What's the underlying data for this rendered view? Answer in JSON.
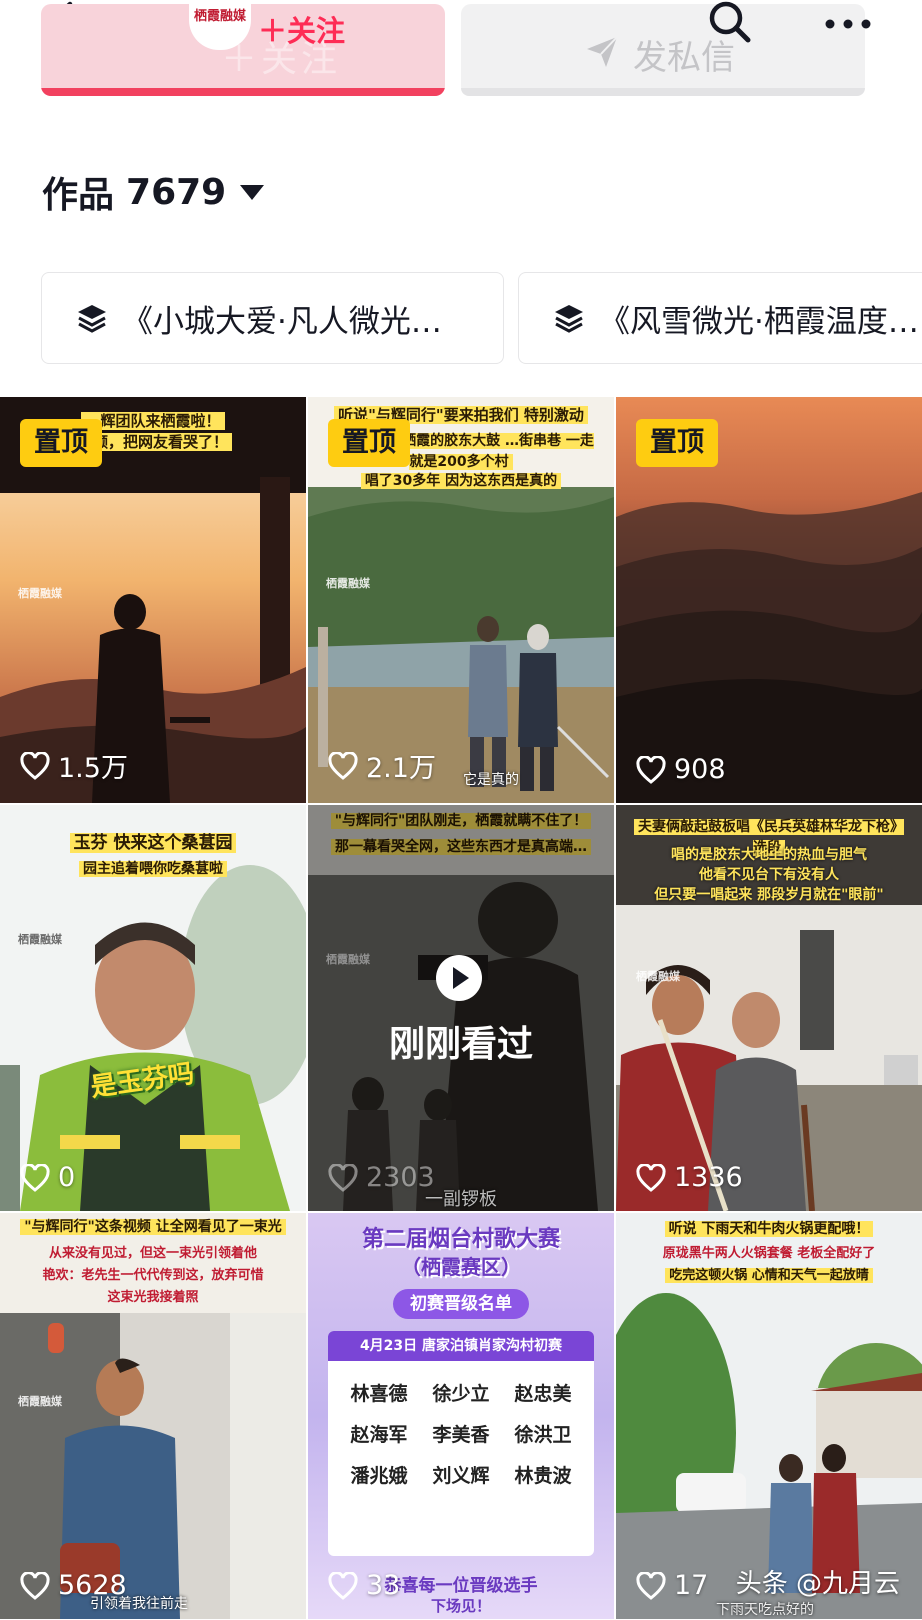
{
  "header": {
    "follow_label": "＋关注",
    "follow_ghost": "＋关注",
    "logo_text": "栖霞融媒",
    "message_label": "发私信"
  },
  "works": {
    "title": "作品",
    "count": "7679"
  },
  "collections": [
    {
      "label": "《小城大爱·凡人微光…"
    },
    {
      "label": "《风雪微光·栖霞温度…"
    }
  ],
  "videos": [
    {
      "pinned": "置顶",
      "caption": "…辉团队来栖霞啦！",
      "caption2": "…频，把网友看哭了！",
      "likes": "1.5万",
      "watermark": "栖霞融媒"
    },
    {
      "pinned": "置顶",
      "caption": "听说\"与辉同行\"要来拍我们 特别激动",
      "caption2": "…多人知道栖霞的胶东大鼓 …街串巷 一走就是200多个村",
      "caption3": "唱了30多年 因为这东西是真的",
      "foot": "它是真的",
      "likes": "2.1万",
      "watermark": "栖霞融媒"
    },
    {
      "pinned": "置顶",
      "likes": "908"
    },
    {
      "caption": "玉芬 快来这个桑葚园",
      "caption2": "园主追着喂你吃桑葚啦",
      "subtitle": "是玉芬吗",
      "likes": "0",
      "watermark": "栖霞融媒"
    },
    {
      "caption": "\"与辉同行\"团队刚走，栖霞就瞒不住了！",
      "caption2": "那一幕看哭全网，这些东西才是真高端…",
      "watched": "刚刚看过",
      "foot": "一副锣板",
      "likes": "2303",
      "watermark": "栖霞融媒"
    },
    {
      "caption": "夫妻俩敲起鼓板唱《民兵英雄林华龙下枪》选段",
      "caption2": "唱的是胶东大地上的热血与胆气",
      "caption3": "他看不见台下有没有人",
      "caption4": "但只要一唱起来 那段岁月就在\"眼前\"",
      "likes": "1336",
      "watermark": "栖霞融媒"
    },
    {
      "caption": "\"与辉同行\"这条视频 让全网看见了一束光",
      "caption2": "从来没有见过，但这一束光引领着他",
      "caption3": "艳欢：老先生一代代传到这，放弃可惜",
      "caption4": "这束光我接着照",
      "foot": "引领着我往前走",
      "likes": "5628",
      "watermark": "栖霞融媒"
    },
    {
      "poster_title": "第二届烟台村歌大赛",
      "poster_sub": "（栖霞赛区）",
      "poster_banner": "初赛晋级名单",
      "poster_date": "4月23日 唐家泊镇肖家沟村初赛",
      "names": [
        "林喜德",
        "徐少立",
        "赵忠美",
        "赵海军",
        "李美香",
        "徐洪卫",
        "潘兆娥",
        "刘义辉",
        "林贵波"
      ],
      "poster_foot": "恭喜每一位晋级选手",
      "poster_foot2": "下场见！",
      "likes": "33"
    },
    {
      "caption": "听说 下雨天和牛肉火锅更配哦！",
      "caption2": "原珑黑牛两人火锅套餐 老板全配好了",
      "caption3": "吃完这顿火锅 心情和天气一起放晴",
      "foot": "下雨天吃点好的",
      "likes": "17"
    }
  ],
  "source_tag": "头条 @九月云",
  "colors": {
    "accent": "#fe2c55",
    "follow_bg": "#f8d3da",
    "pinned_bg": "#fecc11"
  }
}
